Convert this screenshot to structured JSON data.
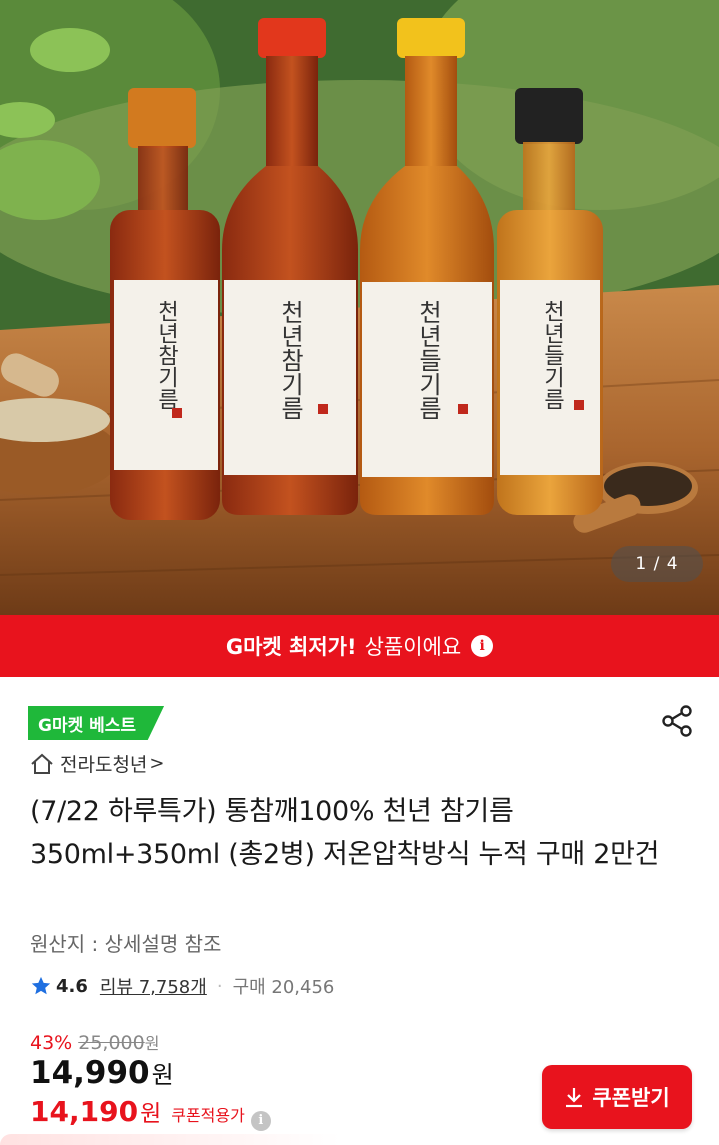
{
  "hero": {
    "image_alt": "four glass bottles of oil on a wooden table",
    "bottle_labels": [
      "천년참기름",
      "천년참기름",
      "천년들기름",
      "천년들기름"
    ],
    "pager": "1 / 4"
  },
  "banner": {
    "strong": "G마켓 최저가!",
    "text": "상품이에요",
    "icon": "info-icon"
  },
  "badge": {
    "label": "G마켓 베스트",
    "color": "#1fb83a"
  },
  "share": {
    "icon": "share-icon"
  },
  "seller": {
    "icon": "home-icon",
    "name": "전라도청년",
    "chevron": ">"
  },
  "product": {
    "title": "(7/22 하루특가) 통참깨100% 천년 참기름 350ml+350ml (총2병) 저온압착방식 누적 구매 2만건",
    "origin": "원산지 : 상세설명 참조"
  },
  "rating": {
    "icon": "star-icon",
    "score": "4.6",
    "review": "리뷰 7,758개",
    "separator": "·",
    "purchases": "구매 20,456"
  },
  "price": {
    "discount_rate": "43%",
    "original": "25,000",
    "original_unit": "원",
    "current": "14,990",
    "current_unit": "원",
    "coupon_price": "14,190",
    "coupon_unit": "원",
    "coupon_label": "쿠폰적용가",
    "coupon_info_icon": "info-icon"
  },
  "coupon_button": {
    "label": "쿠폰받기",
    "icon": "download-icon"
  },
  "colors": {
    "accent": "#e8131d",
    "best": "#1fb83a"
  }
}
